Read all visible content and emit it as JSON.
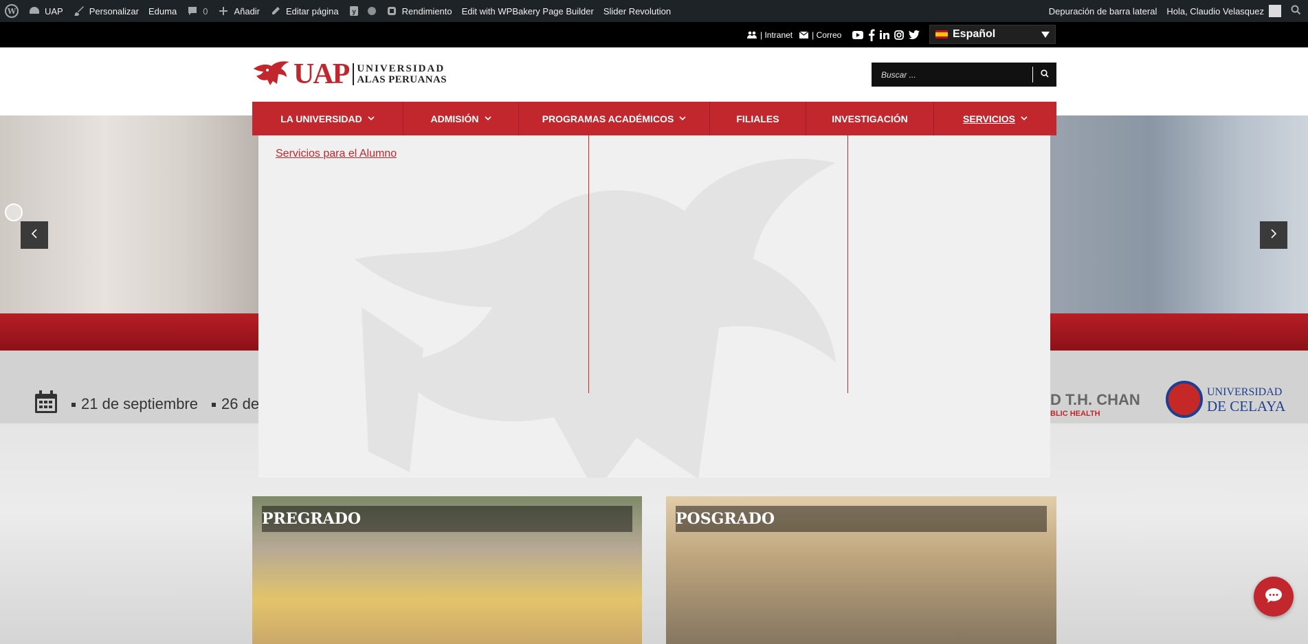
{
  "adminbar": {
    "site_name": "UAP",
    "customize": "Personalizar",
    "theme": "Eduma",
    "comments_count": "0",
    "add_new": "Añadir",
    "edit_page": "Editar página",
    "performance": "Rendimiento",
    "wpbakery": "Edit with WPBakery Page Builder",
    "slider_revolution": "Slider Revolution",
    "debug_sidebar": "Depuración de barra lateral",
    "greeting": "Hola, Claudio Velasquez"
  },
  "topbar": {
    "intranet": "| Intranet",
    "correo": "| Correo",
    "language": "Español"
  },
  "logo": {
    "acronym": "UAP",
    "line1": "UNIVERSIDAD",
    "line2": "ALAS PERUANAS"
  },
  "search": {
    "placeholder": "Buscar ..."
  },
  "nav": {
    "items": [
      {
        "label": "LA UNIVERSIDAD"
      },
      {
        "label": "ADMISIÓN"
      },
      {
        "label": "PROGRAMAS ACADÉMICOS"
      },
      {
        "label": "FILIALES"
      },
      {
        "label": "INVESTIGACIÓN"
      },
      {
        "label": "SERVICIOS"
      }
    ]
  },
  "dropdown": {
    "link": "Servicios para el Alumno"
  },
  "slider": {
    "date1": "21 de septiembre",
    "date2": "26 de",
    "partner1_name": "D T.H. CHAN",
    "partner1_sub": "BLIC HEALTH",
    "partner2_line1": "UNIVERSIDAD",
    "partner2_line2": "DE CELAYA"
  },
  "cards": {
    "pregrado": "PREGRADO",
    "posgrado": "POSGRADO"
  },
  "colors": {
    "brand_red": "#c1272d",
    "admin_bar": "#1d2327"
  }
}
